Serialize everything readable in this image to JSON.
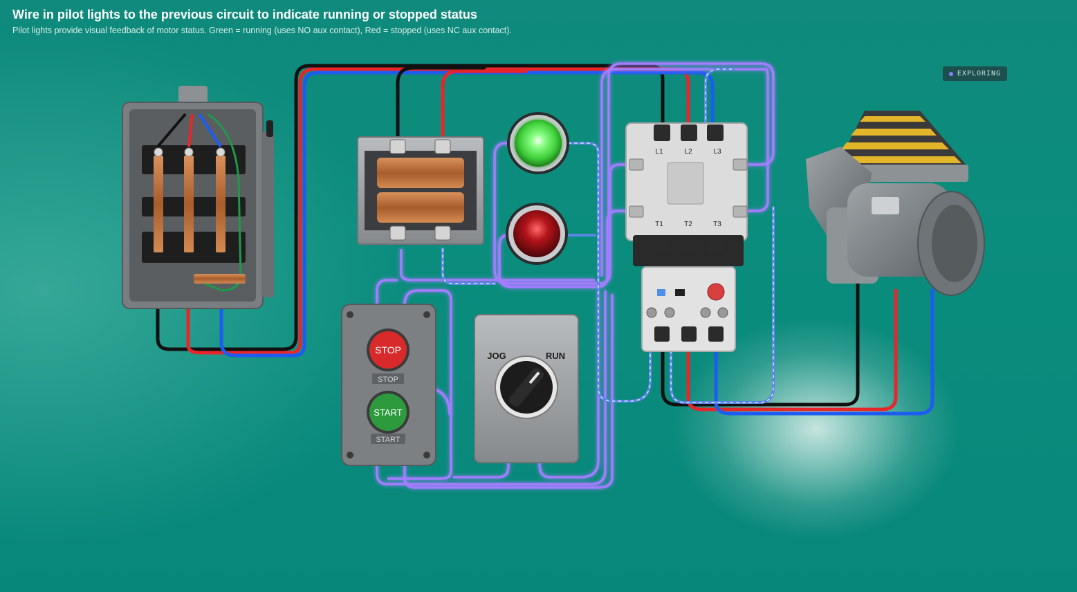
{
  "header": {
    "title": "Wire in pilot lights to the previous circuit to indicate running or stopped status",
    "subtitle": "Pilot lights provide visual feedback of motor status. Green = running (uses NO aux contact), Red = stopped (uses NC aux contact)."
  },
  "status_badge": {
    "label": "EXPLORING",
    "dot_color": "#8b7dff"
  },
  "contactor": {
    "line_terminals": [
      "L1",
      "L2",
      "L3"
    ],
    "load_terminals": [
      "T1",
      "T2",
      "T3"
    ]
  },
  "pushbutton_station": {
    "stop_label": "STOP",
    "stop_plate": "STOP",
    "start_label": "START",
    "start_plate": "START"
  },
  "selector_switch": {
    "left_label": "JOG",
    "right_label": "RUN"
  },
  "pilot_lights": {
    "running_color": "#6dff6a",
    "stopped_color": "#c8161a"
  },
  "wire_colors": {
    "L1": "#111111",
    "L2": "#e8262a",
    "L3": "#1d5cf0",
    "ground": "#1f9a4a",
    "control": "#9a6dff",
    "neutral_striped": "#6a8ee8"
  }
}
